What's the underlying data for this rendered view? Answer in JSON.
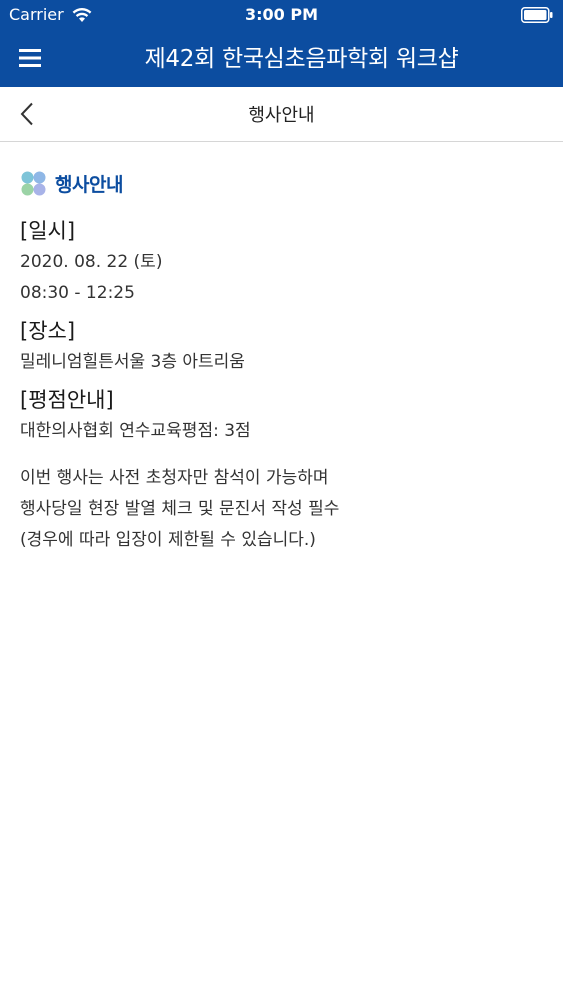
{
  "status_bar": {
    "carrier": "Carrier",
    "time": "3:00 PM",
    "wifi_icon": "wifi-icon",
    "battery_icon": "battery-icon"
  },
  "header": {
    "title": "제42회 한국심초음파학회 워크샵",
    "menu_icon": "hamburger-menu-icon",
    "color": "#0c4da0"
  },
  "sub_nav": {
    "title": "행사안내",
    "back_icon": "chevron-left-icon"
  },
  "content": {
    "section_title": "행사안내",
    "section_icon": "clover-icon",
    "date_label": "[일시]",
    "date_line1": "2020. 08. 22 (토)",
    "date_line2": "08:30 - 12:25",
    "place_label": "[장소]",
    "place_value": "밀레니엄힐튼서울 3층 아트리움",
    "credit_label": "[평점안내]",
    "credit_value": "대한의사협회 연수교육평점: 3점",
    "notice_line1": "이번 행사는 사전 초청자만 참석이 가능하며",
    "notice_line2": "행사당일 현장 발열 체크 및 문진서 작성 필수",
    "notice_line3": "(경우에 따라 입장이 제한될 수 있습니다.)"
  }
}
